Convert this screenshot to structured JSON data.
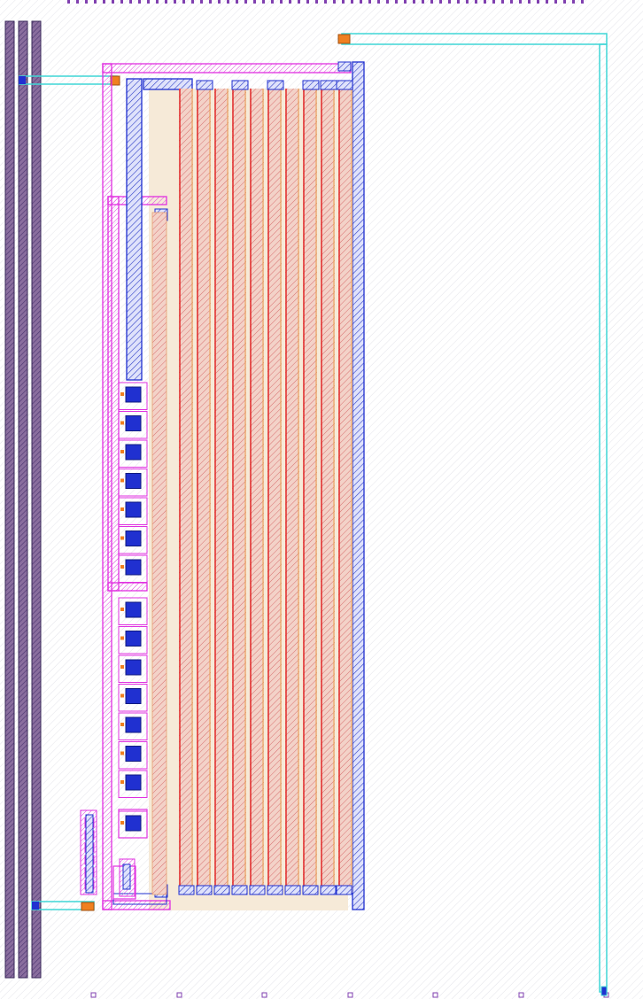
{
  "colors": {
    "background": "#ffffff",
    "background_hatch": "#e4e4ea",
    "rail_fill": "#7a5c8c",
    "rail_stroke": "#3a2a5a",
    "diffusion": "#f6ead8",
    "poly_red": "#e02020",
    "poly_fill": "#e8b8b0",
    "metal_blue": "#2030d0",
    "metal2_cyan": "#3fd6d6",
    "outline_magenta": "#e030e0",
    "via_orange": "#f08020",
    "pin_purple": "#8040b0"
  },
  "icons": [
    "layout-hatch-pattern",
    "via-contact-icon"
  ]
}
